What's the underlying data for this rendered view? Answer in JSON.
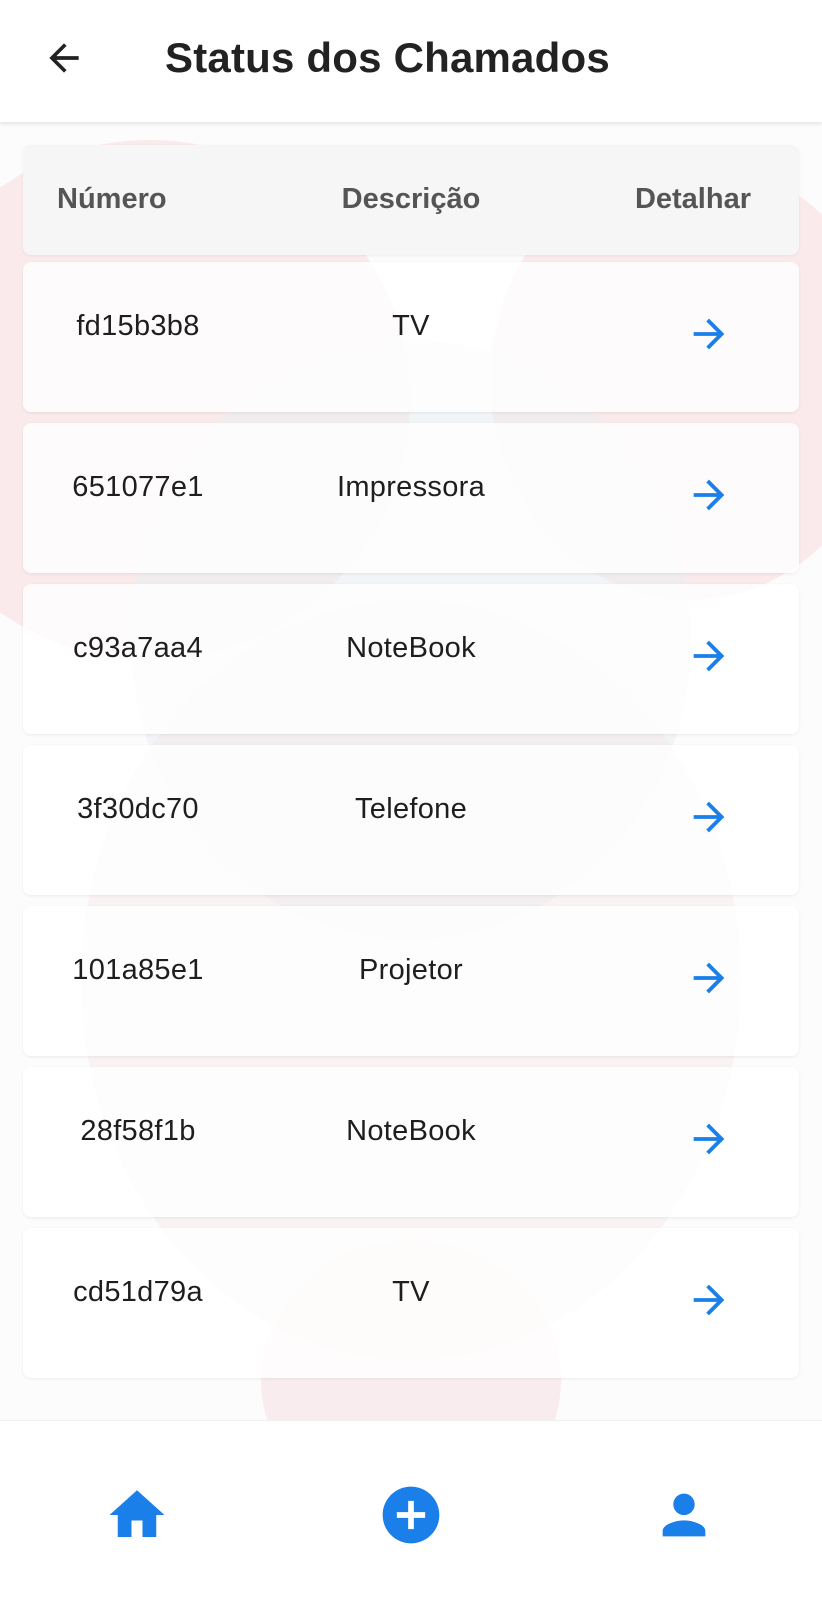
{
  "header": {
    "title": "Status dos Chamados",
    "back_icon": "arrow-left-icon"
  },
  "table": {
    "columns": [
      "Número",
      "Descrição",
      "Detalhar"
    ],
    "rows": [
      {
        "numero": "fd15b3b8",
        "descricao": "TV"
      },
      {
        "numero": "651077e1",
        "descricao": "Impressora"
      },
      {
        "numero": "c93a7aa4",
        "descricao": "NoteBook"
      },
      {
        "numero": "3f30dc70",
        "descricao": "Telefone"
      },
      {
        "numero": "101a85e1",
        "descricao": "Projetor"
      },
      {
        "numero": "28f58f1b",
        "descricao": "NoteBook"
      },
      {
        "numero": "cd51d79a",
        "descricao": "TV"
      }
    ],
    "row_action_icon": "arrow-right-icon"
  },
  "bottom_nav": {
    "items": [
      {
        "icon": "home-icon"
      },
      {
        "icon": "add-circle-icon"
      },
      {
        "icon": "person-icon"
      }
    ]
  },
  "colors": {
    "accent": "#1a7fe8",
    "title_text": "#222222",
    "header_text": "#555555",
    "body_text": "#1e1e1e"
  }
}
